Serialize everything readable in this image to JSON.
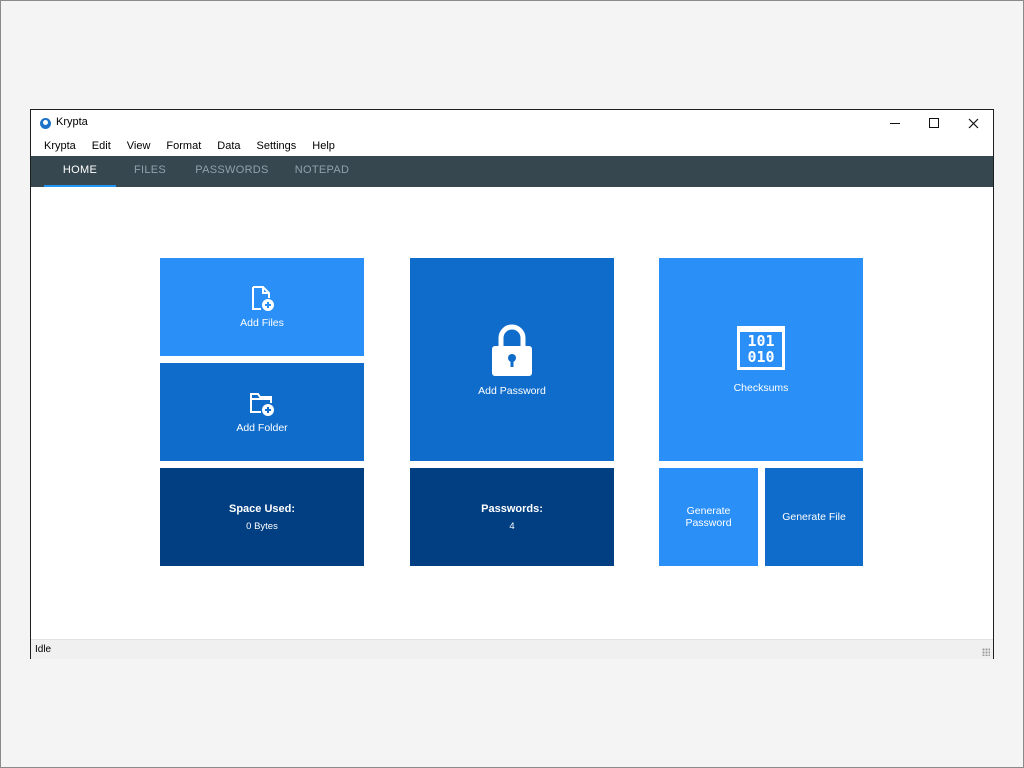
{
  "window": {
    "title": "Krypta"
  },
  "menu": [
    "Krypta",
    "Edit",
    "View",
    "Format",
    "Data",
    "Settings",
    "Help"
  ],
  "tabs": [
    {
      "label": "HOME",
      "active": true
    },
    {
      "label": "FILES",
      "active": false
    },
    {
      "label": "PASSWORDS",
      "active": false
    },
    {
      "label": "NOTEPAD",
      "active": false
    }
  ],
  "tiles": {
    "add_files": {
      "label": "Add Files",
      "icon": "file-add-icon"
    },
    "add_folder": {
      "label": "Add Folder",
      "icon": "folder-add-icon"
    },
    "space_used": {
      "label": "Space Used:",
      "value": "0 Bytes"
    },
    "add_password": {
      "label": "Add Password",
      "icon": "lock-icon"
    },
    "passwords": {
      "label": "Passwords:",
      "value": "4"
    },
    "checksums": {
      "label": "Checksums",
      "icon": "binary-icon",
      "binary_line1": "101",
      "binary_line2": "010"
    },
    "generate_password": {
      "label_line1": "Generate",
      "label_line2": "Password"
    },
    "generate_file": {
      "label": "Generate File"
    }
  },
  "status": {
    "text": "Idle"
  },
  "colors": {
    "tile_light": "#2a8ff7",
    "tile_mid": "#0f6ccb",
    "tile_dark": "#023f82",
    "tabbar": "#37474f",
    "tab_accent": "#2196f3"
  }
}
